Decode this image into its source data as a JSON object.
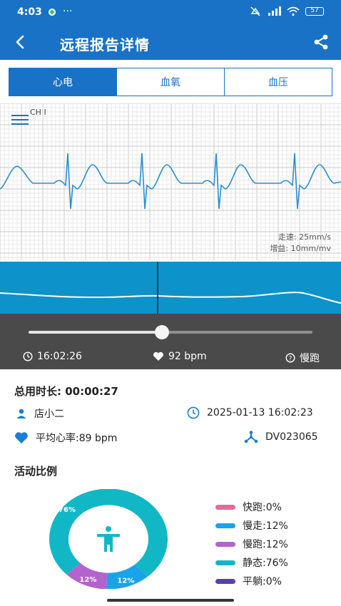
{
  "status": {
    "time": "4:03",
    "more": "···",
    "network": "HD",
    "battery": "57"
  },
  "header": {
    "title": "远程报告详情"
  },
  "tabs": [
    {
      "label": "心电",
      "active": true
    },
    {
      "label": "血氧",
      "active": false
    },
    {
      "label": "血压",
      "active": false
    }
  ],
  "ecg": {
    "channel": "CH I",
    "speed": "走速: 25mm/s",
    "gain": "增益: 10mm/mv"
  },
  "playback": {
    "progress": 0.47,
    "time": "16:02:26",
    "bpm": "92 bpm",
    "activity": "慢跑"
  },
  "report": {
    "duration": "总用时长: 00:00:27",
    "user": "店小二",
    "datetime": "2025-01-13 16:02:23",
    "avg_hr": "平均心率:89 bpm",
    "device": "DV023065"
  },
  "activity": {
    "title": "活动比例",
    "legend": [
      {
        "label": "快跑:0%",
        "color": "#e8699a"
      },
      {
        "label": "慢走:12%",
        "color": "#1aa3e8"
      },
      {
        "label": "慢跑:12%",
        "color": "#b264cc"
      },
      {
        "label": "静态:76%",
        "color": "#12b7c6"
      },
      {
        "label": "平躺:0%",
        "color": "#5a3fb0"
      }
    ],
    "slices": [
      {
        "label": "76%",
        "value": 76,
        "color": "#12b7c6"
      },
      {
        "label": "12%",
        "value": 12,
        "color": "#1aa3e8"
      },
      {
        "label": "12%",
        "value": 12,
        "color": "#b264cc"
      }
    ]
  }
}
